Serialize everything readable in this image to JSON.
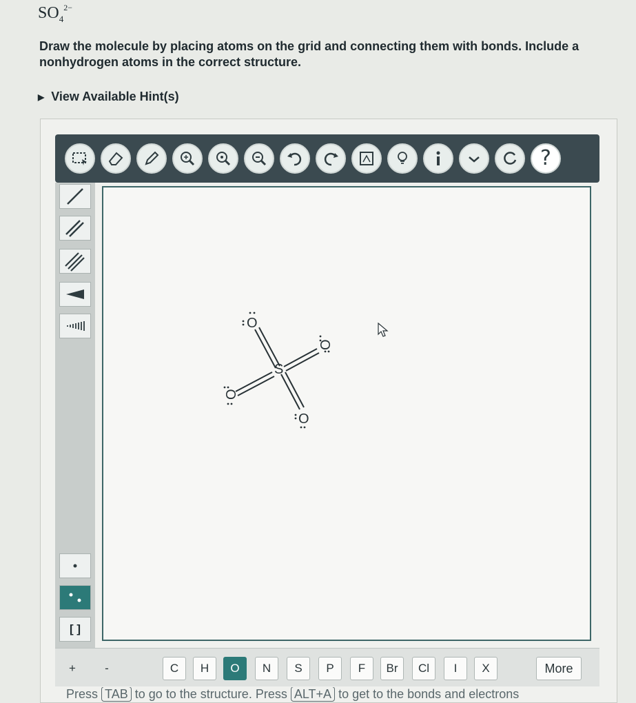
{
  "problem": {
    "formula_base": "SO",
    "formula_sub": "4",
    "formula_sup": "2−",
    "instructions_line1": "Draw the molecule by placing atoms on the grid and connecting them with bonds. Include a",
    "instructions_line2": "nonhydrogen atoms in the correct structure.",
    "hint_label": "View Available Hint(s)"
  },
  "toolbar": {
    "buttons": [
      "select-icon",
      "eraser-icon",
      "pencil-icon",
      "zoom-fit-icon",
      "zoom-in-icon",
      "zoom-out-icon",
      "undo-icon",
      "redo-icon",
      "template-icon",
      "lightbulb-icon",
      "info-icon",
      "check-icon",
      "reset-icon",
      "help-icon"
    ],
    "help_glyph": "?"
  },
  "sidebar": {
    "tools": [
      "single-bond-icon",
      "double-bond-icon",
      "triple-bond-icon",
      "wedge-bond-icon",
      "hash-bond-icon",
      "radical-icon",
      "lone-pair-icon",
      "bracket-icon"
    ],
    "bracket_glyph": "[ ]"
  },
  "molecule": {
    "center_atom": "S",
    "atoms": [
      "O",
      "O",
      "O",
      "O"
    ]
  },
  "bottom": {
    "charge_plus": "+",
    "charge_minus": "-",
    "elements": [
      "C",
      "H",
      "O",
      "N",
      "S",
      "P",
      "F",
      "Br",
      "Cl",
      "I",
      "X"
    ],
    "selected_element": "O",
    "more_label": "More"
  },
  "footer": {
    "press": "Press",
    "tab_key": "TAB",
    "text1": "to go to the structure. Press",
    "alt_key": "ALT+A",
    "text2": "to get to the bonds and electrons"
  },
  "colors": {
    "accent": "#2c7a78",
    "toolbar": "#3b4a50"
  }
}
